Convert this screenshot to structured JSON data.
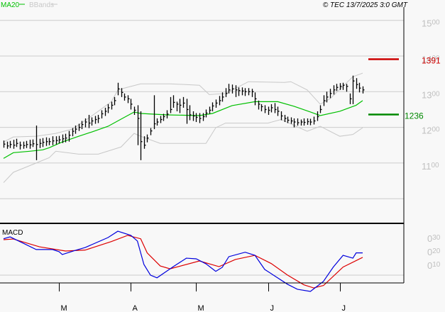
{
  "header": {
    "legend_ma": "MA20",
    "legend_bb": "BBands",
    "copyright": "© TEC 13/7/2025 3:0 GMT"
  },
  "colors": {
    "background": "#f8f8f8",
    "grid": "#cccccc",
    "bars": "#000000",
    "ma20": "#00c000",
    "bbands": "#c8c8c8",
    "macd": "#0000dd",
    "signal": "#dd0000",
    "resistance": "#cc0000",
    "support": "#008800",
    "axis_label": "#c0c0c0"
  },
  "chart_data": [
    {
      "type": "ohlc",
      "panel": "price",
      "ylim": [
        1000,
        1500
      ],
      "yticks": [
        {
          "big": "15",
          "small": "00",
          "value": 1500
        },
        {
          "big": "14",
          "small": "00",
          "value": 1400
        },
        {
          "big": "13",
          "small": "00",
          "value": 1300
        },
        {
          "big": "12",
          "small": "00",
          "value": 1200
        },
        {
          "big": "11",
          "small": "00",
          "value": 1100
        }
      ],
      "grid": true,
      "month_ticks": [
        {
          "label": "M",
          "bar": 17
        },
        {
          "label": "A",
          "bar": 39
        },
        {
          "label": "M",
          "bar": 59
        },
        {
          "label": "J",
          "bar": 81
        },
        {
          "label": "J",
          "bar": 103
        }
      ],
      "close": [
        1153,
        1148,
        1152,
        1150,
        1155,
        1150,
        1149,
        1152,
        1151,
        1154,
        1152,
        1155,
        1158,
        1160,
        1160,
        1162,
        1163,
        1165,
        1168,
        1170,
        1178,
        1189,
        1195,
        1200,
        1208,
        1215,
        1212,
        1218,
        1222,
        1225,
        1238,
        1245,
        1255,
        1262,
        1275,
        1308,
        1298,
        1285,
        1280,
        1265,
        1248,
        1225,
        1160,
        1150,
        1170,
        1190,
        1210,
        1215,
        1222,
        1230,
        1237,
        1250,
        1270,
        1265,
        1262,
        1268,
        1250,
        1235,
        1232,
        1228,
        1225,
        1230,
        1240,
        1248,
        1260,
        1268,
        1275,
        1285,
        1295,
        1305,
        1308,
        1305,
        1303,
        1302,
        1300,
        1300,
        1300,
        1280,
        1265,
        1258,
        1250,
        1248,
        1255,
        1250,
        1245,
        1232,
        1225,
        1220,
        1218,
        1215,
        1213,
        1215,
        1214,
        1216,
        1215,
        1218,
        1230,
        1250,
        1275,
        1285,
        1295,
        1305,
        1312,
        1315,
        1318,
        1315,
        1280,
        1330,
        1320,
        1310,
        1305
      ],
      "high": [
        1163,
        1160,
        1162,
        1165,
        1168,
        1160,
        1160,
        1162,
        1165,
        1166,
        1205,
        1168,
        1170,
        1172,
        1170,
        1175,
        1175,
        1176,
        1180,
        1182,
        1190,
        1198,
        1205,
        1210,
        1218,
        1225,
        1235,
        1228,
        1232,
        1235,
        1248,
        1255,
        1265,
        1272,
        1285,
        1325,
        1310,
        1295,
        1290,
        1280,
        1258,
        1262,
        1245,
        1175,
        1180,
        1198,
        1290,
        1225,
        1232,
        1238,
        1248,
        1285,
        1290,
        1272,
        1280,
        1285,
        1280,
        1262,
        1245,
        1240,
        1240,
        1240,
        1250,
        1258,
        1270,
        1278,
        1288,
        1298,
        1310,
        1322,
        1320,
        1318,
        1312,
        1312,
        1310,
        1310,
        1308,
        1298,
        1275,
        1265,
        1262,
        1258,
        1265,
        1268,
        1258,
        1245,
        1235,
        1230,
        1228,
        1225,
        1225,
        1222,
        1225,
        1225,
        1224,
        1230,
        1245,
        1262,
        1290,
        1300,
        1308,
        1318,
        1322,
        1324,
        1325,
        1322,
        1295,
        1345,
        1338,
        1325,
        1315
      ],
      "low": [
        1143,
        1140,
        1142,
        1140,
        1145,
        1138,
        1140,
        1142,
        1140,
        1145,
        1108,
        1142,
        1145,
        1148,
        1150,
        1150,
        1152,
        1155,
        1156,
        1158,
        1160,
        1175,
        1182,
        1190,
        1195,
        1200,
        1198,
        1205,
        1210,
        1212,
        1225,
        1232,
        1240,
        1250,
        1262,
        1290,
        1285,
        1275,
        1268,
        1250,
        1235,
        1150,
        1108,
        1140,
        1158,
        1178,
        1195,
        1205,
        1212,
        1218,
        1225,
        1240,
        1255,
        1245,
        1240,
        1255,
        1210,
        1220,
        1218,
        1215,
        1212,
        1218,
        1228,
        1238,
        1245,
        1255,
        1262,
        1272,
        1285,
        1295,
        1295,
        1285,
        1288,
        1290,
        1288,
        1290,
        1285,
        1262,
        1250,
        1245,
        1240,
        1235,
        1242,
        1240,
        1232,
        1220,
        1215,
        1212,
        1210,
        1200,
        1205,
        1205,
        1205,
        1207,
        1206,
        1208,
        1218,
        1240,
        1260,
        1270,
        1282,
        1292,
        1302,
        1305,
        1305,
        1300,
        1265,
        1265,
        1308,
        1298,
        1295
      ],
      "ma20": [
        [
          0,
          1113
        ],
        [
          3,
          1129
        ],
        [
          8,
          1133
        ],
        [
          12,
          1137
        ],
        [
          14,
          1143
        ],
        [
          18,
          1159
        ],
        [
          23,
          1175
        ],
        [
          27,
          1187
        ],
        [
          32,
          1203
        ],
        [
          36,
          1223
        ],
        [
          40,
          1243
        ],
        [
          42,
          1239
        ],
        [
          46,
          1237
        ],
        [
          50,
          1235
        ],
        [
          60,
          1233
        ],
        [
          64,
          1239
        ],
        [
          70,
          1261
        ],
        [
          77,
          1272
        ],
        [
          84,
          1272
        ],
        [
          89,
          1259
        ],
        [
          94,
          1243
        ],
        [
          97,
          1233
        ],
        [
          103,
          1245
        ],
        [
          108,
          1262
        ],
        [
          110,
          1275
        ]
      ],
      "bb_upper": [
        [
          0,
          1159
        ],
        [
          3,
          1173
        ],
        [
          10,
          1175
        ],
        [
          16,
          1183
        ],
        [
          21,
          1195
        ],
        [
          25,
          1219
        ],
        [
          29,
          1245
        ],
        [
          33,
          1272
        ],
        [
          35,
          1304
        ],
        [
          37,
          1310
        ],
        [
          42,
          1322
        ],
        [
          51,
          1322
        ],
        [
          60,
          1318
        ],
        [
          63,
          1292
        ],
        [
          68,
          1295
        ],
        [
          75,
          1328
        ],
        [
          86,
          1326
        ],
        [
          88,
          1328
        ],
        [
          93,
          1305
        ],
        [
          97,
          1265
        ],
        [
          100,
          1280
        ],
        [
          107,
          1342
        ],
        [
          110,
          1352
        ]
      ],
      "bb_lower": [
        [
          0,
          1045
        ],
        [
          3,
          1074
        ],
        [
          10,
          1100
        ],
        [
          14,
          1115
        ],
        [
          16,
          1133
        ],
        [
          23,
          1125
        ],
        [
          29,
          1125
        ],
        [
          36,
          1145
        ],
        [
          40,
          1183
        ],
        [
          42,
          1175
        ],
        [
          48,
          1155
        ],
        [
          62,
          1155
        ],
        [
          65,
          1199
        ],
        [
          68,
          1212
        ],
        [
          81,
          1212
        ],
        [
          85,
          1222
        ],
        [
          93,
          1189
        ],
        [
          97,
          1203
        ],
        [
          103,
          1175
        ],
        [
          107,
          1180
        ],
        [
          110,
          1199
        ]
      ],
      "levels": [
        {
          "value": 1391,
          "label": "1391",
          "kind": "resistance"
        },
        {
          "value": 1236,
          "label": "1236",
          "kind": "support"
        }
      ]
    },
    {
      "type": "line",
      "panel": "macd",
      "title": "MACD",
      "yticks": [
        {
          "big": "0",
          "small": "30",
          "value": 0.3
        },
        {
          "big": "0",
          "small": "20",
          "value": 0.2
        },
        {
          "big": "0",
          "small": "10",
          "value": 0.1
        }
      ],
      "grid_values": [
        0.0
      ],
      "macd": [
        [
          0,
          0.27
        ],
        [
          2,
          0.284
        ],
        [
          6,
          0.237
        ],
        [
          10,
          0.19
        ],
        [
          15,
          0.19
        ],
        [
          17,
          0.174
        ],
        [
          18,
          0.153
        ],
        [
          22,
          0.184
        ],
        [
          25,
          0.205
        ],
        [
          32,
          0.279
        ],
        [
          35,
          0.326
        ],
        [
          39,
          0.295
        ],
        [
          41,
          0.253
        ],
        [
          43,
          0.079
        ],
        [
          45,
          0.0
        ],
        [
          47,
          -0.02
        ],
        [
          52,
          0.063
        ],
        [
          56,
          0.126
        ],
        [
          59,
          0.121
        ],
        [
          62,
          0.084
        ],
        [
          65,
          0.028
        ],
        [
          67,
          0.058
        ],
        [
          69,
          0.137
        ],
        [
          74,
          0.17
        ],
        [
          77,
          0.147
        ],
        [
          80,
          0.042
        ],
        [
          83,
          -0.005
        ],
        [
          87,
          -0.068
        ],
        [
          90,
          -0.105
        ],
        [
          94,
          -0.121
        ],
        [
          98,
          -0.046
        ],
        [
          101,
          0.06
        ],
        [
          104,
          0.147
        ],
        [
          107,
          0.126
        ],
        [
          108,
          0.165
        ],
        [
          110,
          0.165
        ]
      ],
      "signal": [
        [
          0,
          0.263
        ],
        [
          3,
          0.268
        ],
        [
          11,
          0.21
        ],
        [
          19,
          0.179
        ],
        [
          25,
          0.186
        ],
        [
          33,
          0.249
        ],
        [
          38,
          0.295
        ],
        [
          42,
          0.27
        ],
        [
          44,
          0.165
        ],
        [
          48,
          0.068
        ],
        [
          51,
          0.047
        ],
        [
          60,
          0.105
        ],
        [
          66,
          0.063
        ],
        [
          71,
          0.116
        ],
        [
          77,
          0.147
        ],
        [
          82,
          0.086
        ],
        [
          87,
          0.0
        ],
        [
          92,
          -0.072
        ],
        [
          95,
          -0.095
        ],
        [
          98,
          -0.077
        ],
        [
          104,
          0.06
        ],
        [
          110,
          0.132
        ]
      ]
    }
  ]
}
